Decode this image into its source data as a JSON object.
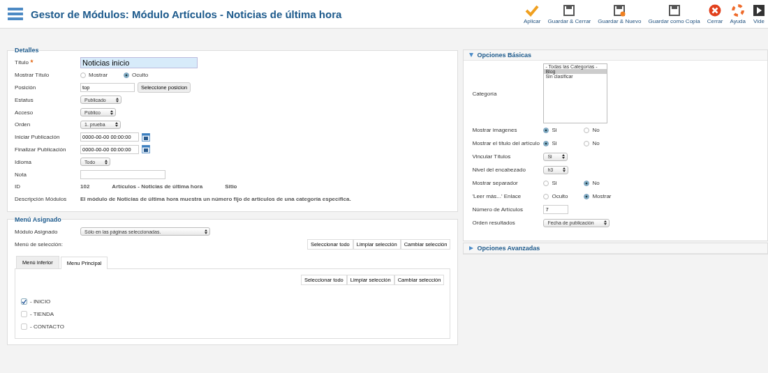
{
  "header": {
    "title": "Gestor de Módulos: Módulo Artículos - Noticias de última hora",
    "toolbar": [
      {
        "label": "Aplicar"
      },
      {
        "label": "Guardar & Cerrar"
      },
      {
        "label": "Guardar & Nuevo"
      },
      {
        "label": "Guardar como Copia"
      },
      {
        "label": "Cerrar"
      },
      {
        "label": "Ayuda"
      },
      {
        "label": "Vide"
      }
    ]
  },
  "details": {
    "legend": "Detalles",
    "fields": [
      {
        "kind": "title",
        "label": "Título",
        "required": true,
        "value": "Noticias inicio"
      },
      {
        "kind": "radio",
        "label": "Mostrar Título",
        "options": [
          {
            "label": "Mostrar",
            "selected": false
          },
          {
            "label": "Oculto",
            "selected": true
          }
        ]
      },
      {
        "kind": "position",
        "label": "Posición",
        "value": "top",
        "button": "Seleccione posicion"
      },
      {
        "kind": "select",
        "label": "Estatus",
        "value": "Publicado"
      },
      {
        "kind": "select",
        "label": "Acceso",
        "value": "Público"
      },
      {
        "kind": "select",
        "label": "Orden",
        "value": "1. prueba"
      },
      {
        "kind": "date",
        "label": "Iniciar Publicación",
        "value": "0000-00-00 00:00:00"
      },
      {
        "kind": "date",
        "label": "Finalizar Publicación",
        "value": "0000-00-00 00:00:00"
      },
      {
        "kind": "select",
        "label": "Idioma",
        "value": "Todo"
      },
      {
        "kind": "text",
        "label": "Nota"
      },
      {
        "kind": "info",
        "label": "ID",
        "values": [
          "102",
          "Artículos - Noticias de última hora",
          "Sitio"
        ]
      },
      {
        "kind": "desc",
        "label": "Descripción Módulos",
        "value": "El módulo de Noticias de última hora muestra un número fijo de artículos de una categoría específica."
      }
    ]
  },
  "menu_assignment": {
    "legend": "Menú Asignado",
    "module_label": "Módulo Asignado",
    "module_value": "Sólo en las páginas seleccionadas.",
    "selection_label": "Menú de selección:",
    "buttons": [
      "Seleccionar todo",
      "Limpiar selección",
      "Cambiar selección"
    ],
    "tabs": [
      {
        "label": "Menú inferior",
        "selected": false
      },
      {
        "label": "Menu Principal",
        "selected": true
      }
    ],
    "inner_buttons": [
      "Seleccionar todo",
      "Limpiar selección",
      "Cambiar selección"
    ],
    "items": [
      {
        "label": "- INICIO",
        "checked": true
      },
      {
        "label": "- TIENDA",
        "checked": false
      },
      {
        "label": "- CONTACTO",
        "checked": false
      }
    ]
  },
  "basic_options": {
    "title": "Opciones Básicas",
    "expanded": true,
    "fields": [
      {
        "kind": "list",
        "label": "Categoría",
        "options": [
          {
            "label": "- Todas las Categorías -",
            "selected": false
          },
          {
            "label": "Blog",
            "selected": true
          },
          {
            "label": "Sin clasificar",
            "selected": false
          }
        ]
      },
      {
        "kind": "radio",
        "label": "Mostrar imagenes",
        "options": [
          {
            "label": "Si",
            "selected": true
          },
          {
            "label": "No",
            "selected": false
          }
        ]
      },
      {
        "kind": "radio",
        "label": "Mostrar el título del artículo",
        "options": [
          {
            "label": "Si",
            "selected": true
          },
          {
            "label": "No",
            "selected": false
          }
        ]
      },
      {
        "kind": "select",
        "label": "Vincular Títulos",
        "value": "Si"
      },
      {
        "kind": "select",
        "label": "Nivel del encabezado",
        "value": "h3"
      },
      {
        "kind": "radio",
        "label": "Mostrar separador",
        "options": [
          {
            "label": "Si",
            "selected": false
          },
          {
            "label": "No",
            "selected": true
          }
        ]
      },
      {
        "kind": "radio",
        "label": "'Leer más...' Enlace",
        "options": [
          {
            "label": "Oculto",
            "selected": false
          },
          {
            "label": "Mostrar",
            "selected": true
          }
        ]
      },
      {
        "kind": "text",
        "label": "Número de Artículos",
        "value": "7"
      },
      {
        "kind": "select",
        "label": "Orden resultados",
        "value": "Fecha de publicación"
      }
    ]
  },
  "advanced_options": {
    "title": "Opciones Avanzadas",
    "expanded": false
  }
}
